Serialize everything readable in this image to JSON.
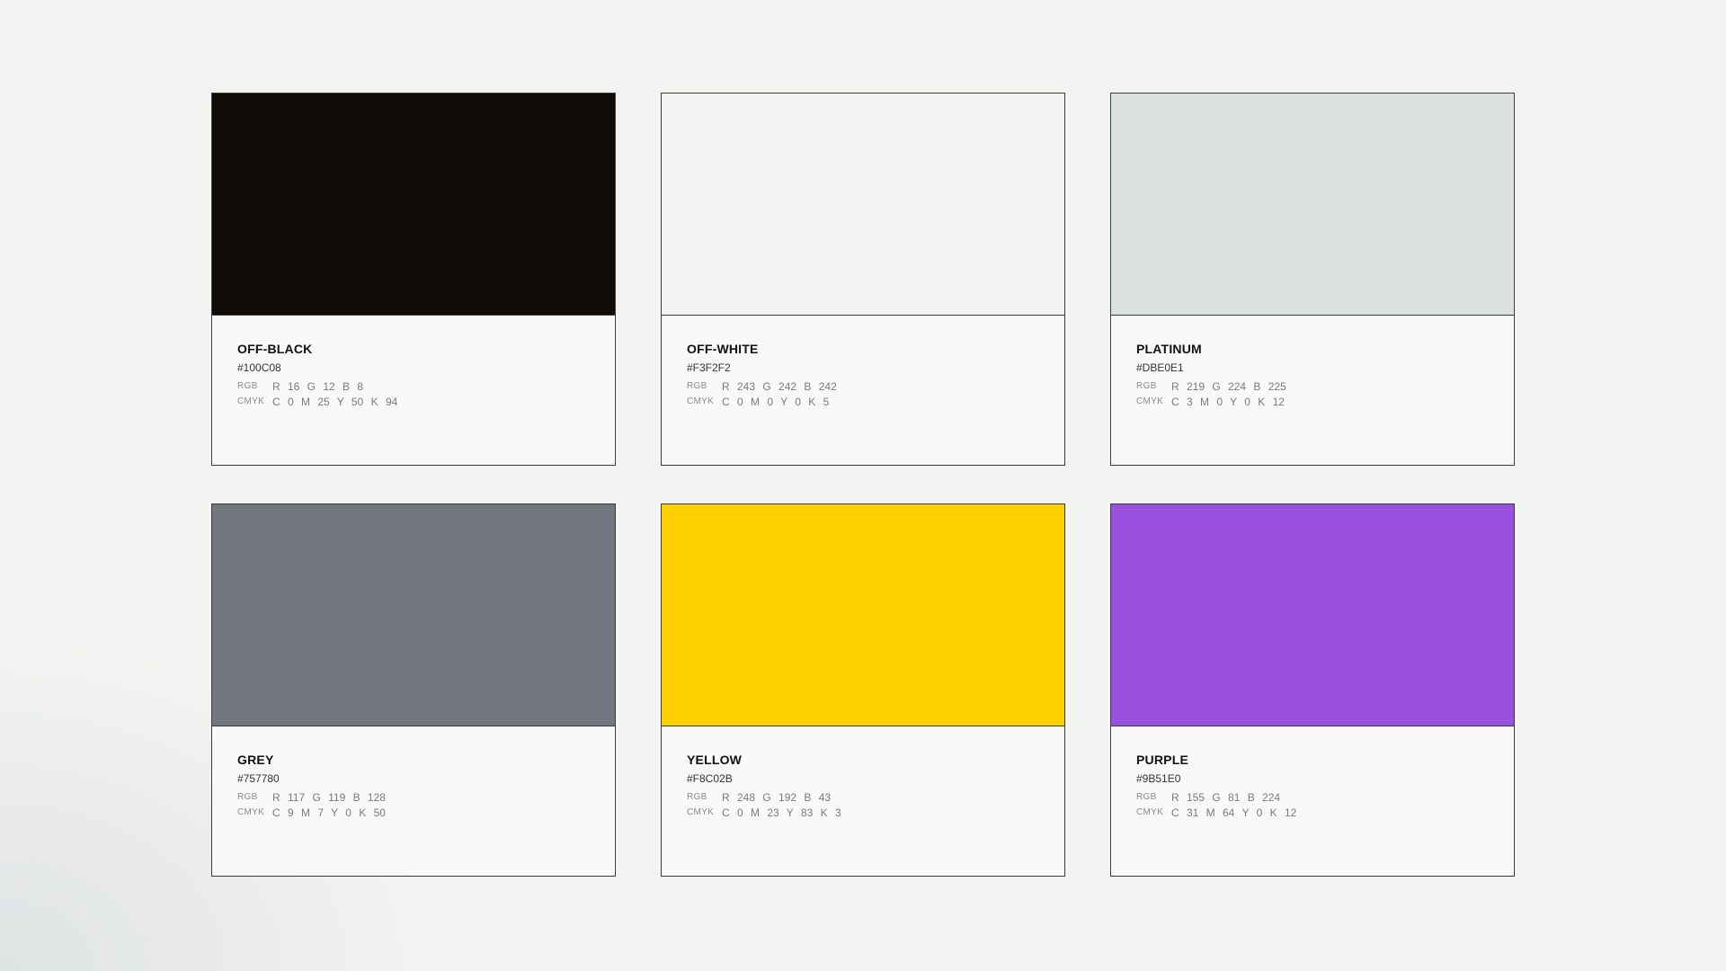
{
  "labels": {
    "rgb": "RGB",
    "cmyk": "CMYK"
  },
  "swatches": [
    {
      "name": "OFF-BLACK",
      "hex": "#100C08",
      "color": "#100c08",
      "rgb": "R 16  G 12  B 8",
      "cmyk": "C 0  M 25  Y 50  K 94"
    },
    {
      "name": "OFF-WHITE",
      "hex": "#F3F2F2",
      "color": "#f3f2f2",
      "rgb": "R 243  G 242  B 242",
      "cmyk": "C 0  M 0  Y 0  K 5"
    },
    {
      "name": "PLATINUM",
      "hex": "#DBE0E1",
      "color": "#dbe0e1",
      "rgb": "R 219  G 224  B 225",
      "cmyk": "C 3  M 0  Y 0  K 12"
    },
    {
      "name": "GREY",
      "hex": "#757780",
      "color": "#757780",
      "rgb": "R 117  G 119  B 128",
      "cmyk": "C 9  M 7  Y 0  K 50"
    },
    {
      "name": "YELLOW",
      "hex": "#F8C02B",
      "color": "#ffd000",
      "rgb": "R 248  G 192  B 43",
      "cmyk": "C 0  M 23  Y 83  K 3"
    },
    {
      "name": "PURPLE",
      "hex": "#9B51E0",
      "color": "#9b51e0",
      "rgb": "R 155  G 81  B 224",
      "cmyk": "C 31  M 64  Y 0  K 12"
    }
  ]
}
